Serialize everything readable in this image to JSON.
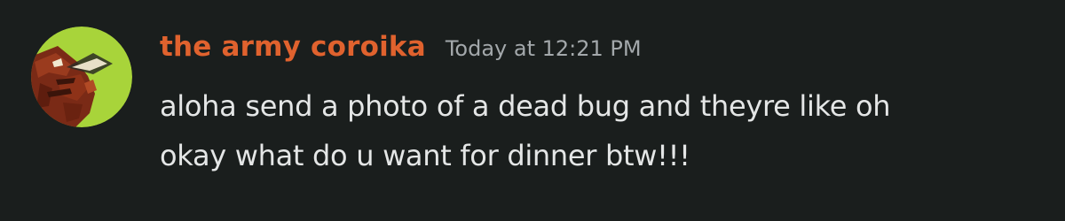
{
  "message": {
    "author": "the army coroika",
    "timestamp": "Today at 12:21 PM",
    "content_lines": [
      "aloha send a photo of a dead bug and theyre like oh",
      "okay what do u want for dinner btw!!!"
    ],
    "colors": {
      "background": "#1a1e1d",
      "username": "#e0622e",
      "timestamp": "#a3a8ab",
      "text": "#e4e6e6",
      "avatar_background": "#a8d43a"
    }
  }
}
